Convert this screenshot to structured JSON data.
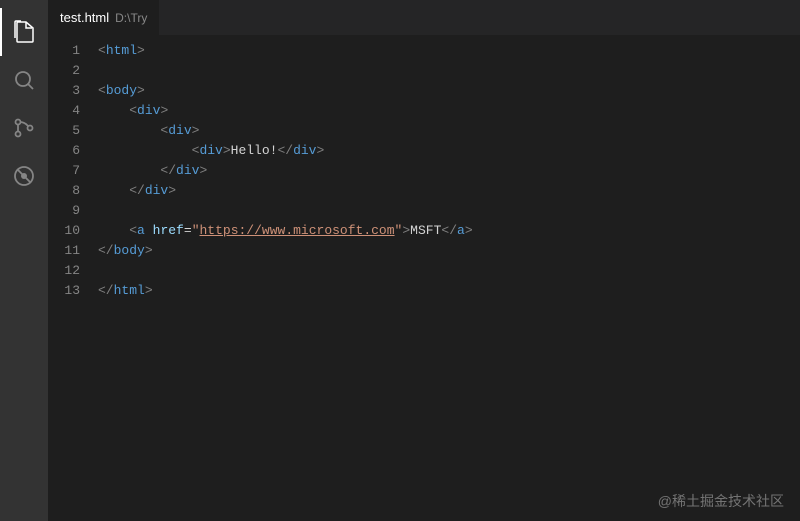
{
  "tab": {
    "filename": "test.html",
    "path": "D:\\Try"
  },
  "lines": [
    {
      "n": 1,
      "indent": 0,
      "segs": [
        {
          "c": "t-bracket",
          "t": "<"
        },
        {
          "c": "t-tag",
          "t": "html"
        },
        {
          "c": "t-bracket",
          "t": ">"
        }
      ]
    },
    {
      "n": 2,
      "indent": 0,
      "segs": []
    },
    {
      "n": 3,
      "indent": 0,
      "segs": [
        {
          "c": "t-bracket",
          "t": "<"
        },
        {
          "c": "t-tag",
          "t": "body"
        },
        {
          "c": "t-bracket",
          "t": ">"
        }
      ]
    },
    {
      "n": 4,
      "indent": 1,
      "segs": [
        {
          "c": "t-bracket",
          "t": "<"
        },
        {
          "c": "t-tag",
          "t": "div"
        },
        {
          "c": "t-bracket",
          "t": ">"
        }
      ]
    },
    {
      "n": 5,
      "indent": 2,
      "segs": [
        {
          "c": "t-bracket",
          "t": "<"
        },
        {
          "c": "t-tag",
          "t": "div"
        },
        {
          "c": "t-bracket",
          "t": ">"
        }
      ]
    },
    {
      "n": 6,
      "indent": 3,
      "segs": [
        {
          "c": "t-bracket",
          "t": "<"
        },
        {
          "c": "t-tag",
          "t": "div"
        },
        {
          "c": "t-bracket",
          "t": ">"
        },
        {
          "c": "t-text",
          "t": "Hello!"
        },
        {
          "c": "t-bracket",
          "t": "</"
        },
        {
          "c": "t-tag",
          "t": "div"
        },
        {
          "c": "t-bracket",
          "t": ">"
        }
      ]
    },
    {
      "n": 7,
      "indent": 2,
      "segs": [
        {
          "c": "t-bracket",
          "t": "</"
        },
        {
          "c": "t-tag",
          "t": "div"
        },
        {
          "c": "t-bracket",
          "t": ">"
        }
      ]
    },
    {
      "n": 8,
      "indent": 1,
      "segs": [
        {
          "c": "t-bracket",
          "t": "</"
        },
        {
          "c": "t-tag",
          "t": "div"
        },
        {
          "c": "t-bracket",
          "t": ">"
        }
      ]
    },
    {
      "n": 9,
      "indent": 0,
      "segs": []
    },
    {
      "n": 10,
      "indent": 1,
      "segs": [
        {
          "c": "t-bracket",
          "t": "<"
        },
        {
          "c": "t-tag",
          "t": "a"
        },
        {
          "c": "t-text",
          "t": " "
        },
        {
          "c": "t-attr",
          "t": "href"
        },
        {
          "c": "t-op",
          "t": "="
        },
        {
          "c": "t-str",
          "t": "\""
        },
        {
          "c": "t-str",
          "t": "https://www.microsoft.com",
          "u": true
        },
        {
          "c": "t-str",
          "t": "\""
        },
        {
          "c": "t-bracket",
          "t": ">"
        },
        {
          "c": "t-text",
          "t": "MSFT"
        },
        {
          "c": "t-bracket",
          "t": "</"
        },
        {
          "c": "t-tag",
          "t": "a"
        },
        {
          "c": "t-bracket",
          "t": ">"
        }
      ]
    },
    {
      "n": 11,
      "indent": 0,
      "segs": [
        {
          "c": "t-bracket",
          "t": "</"
        },
        {
          "c": "t-tag",
          "t": "body"
        },
        {
          "c": "t-bracket",
          "t": ">"
        }
      ]
    },
    {
      "n": 12,
      "indent": 0,
      "segs": []
    },
    {
      "n": 13,
      "indent": 0,
      "segs": [
        {
          "c": "t-bracket",
          "t": "</"
        },
        {
          "c": "t-tag",
          "t": "html"
        },
        {
          "c": "t-bracket",
          "t": ">"
        }
      ]
    }
  ],
  "watermark": "@稀土掘金技术社区"
}
